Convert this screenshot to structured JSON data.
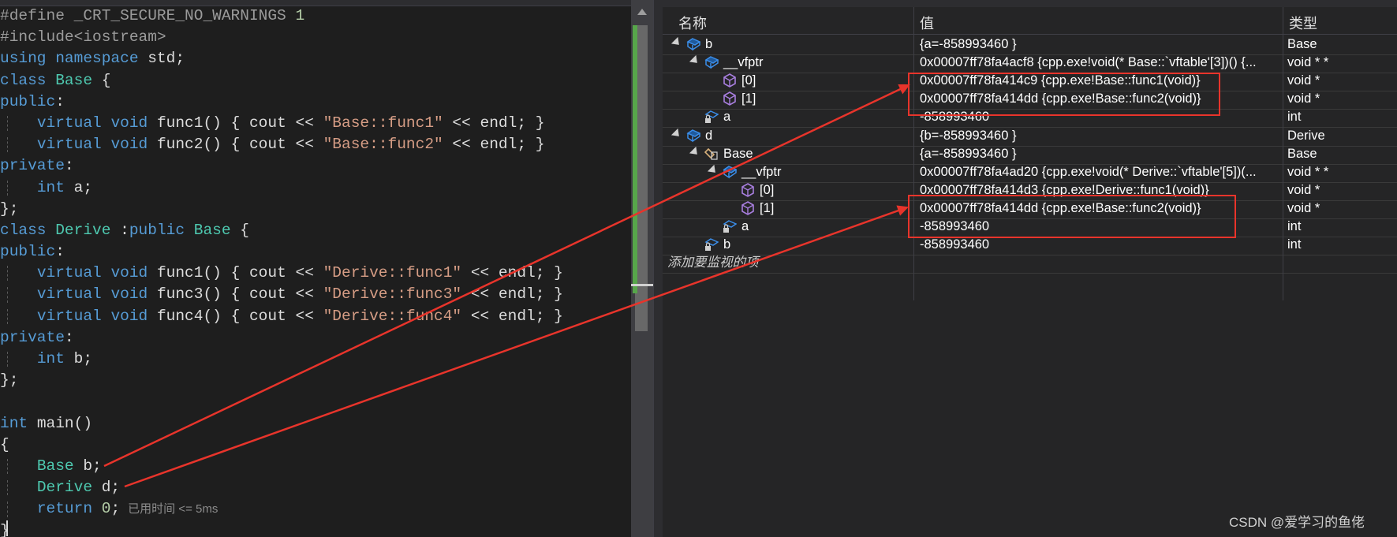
{
  "editor": {
    "lines": [
      {
        "t": "pp",
        "text": "#define _CRT_SECURE_NO_WARNINGS 1"
      },
      {
        "t": "pp",
        "text": "#include<iostream>"
      },
      {
        "t": "kw",
        "text": "using namespace std;"
      },
      {
        "t": "cls",
        "kw": "class",
        "name": "Base",
        "rest": " {"
      },
      {
        "t": "kw",
        "text": "public:"
      },
      {
        "t": "vf",
        "fn": "func1",
        "body": "{ cout << ",
        "str": "\"Base::func1\"",
        "tail": " << endl; }"
      },
      {
        "t": "vf",
        "fn": "func2",
        "body": "{ cout << ",
        "str": "\"Base::func2\"",
        "tail": " << endl; }"
      },
      {
        "t": "kw",
        "text": "private:"
      },
      {
        "t": "decl",
        "text": "int a;"
      },
      {
        "t": "plain",
        "text": "};"
      },
      {
        "t": "cls2",
        "kw": "class",
        "name": "Derive",
        "mid": " :public ",
        "base": "Base",
        "rest": " {"
      },
      {
        "t": "kw",
        "text": "public:"
      },
      {
        "t": "vf",
        "fn": "func1",
        "body": "{ cout << ",
        "str": "\"Derive::func1\"",
        "tail": " << endl; }"
      },
      {
        "t": "vf",
        "fn": "func3",
        "body": "{ cout << ",
        "str": "\"Derive::func3\"",
        "tail": " << endl; }"
      },
      {
        "t": "vf",
        "fn": "func4",
        "body": "{ cout << ",
        "str": "\"Derive::func4\"",
        "tail": " << endl; }"
      },
      {
        "t": "kw",
        "text": "private:"
      },
      {
        "t": "decl",
        "text": "int b;"
      },
      {
        "t": "plain",
        "text": "};"
      },
      {
        "t": "plain",
        "text": ""
      },
      {
        "t": "main",
        "text": "int main()"
      },
      {
        "t": "plain",
        "text": "{"
      },
      {
        "t": "var",
        "ty": "Base",
        "text": " b;"
      },
      {
        "t": "var",
        "ty": "Derive",
        "text": " d;"
      },
      {
        "t": "ret",
        "text": "return 0;",
        "perf": "已用时间 <= 5ms"
      },
      {
        "t": "plain",
        "text": "}"
      }
    ],
    "virtual_kw": "virtual",
    "void_kw": "void",
    "parens": "() "
  },
  "watch": {
    "headers": {
      "name": "名称",
      "value": "值",
      "type": "类型"
    },
    "rows": [
      {
        "level": 0,
        "expand": true,
        "icon": "object-icon",
        "name": "b",
        "value": "{a=-858993460 }",
        "type": "Base"
      },
      {
        "level": 1,
        "expand": true,
        "icon": "object-icon",
        "name": "__vfptr",
        "value": "0x00007ff78fa4acf8 {cpp.exe!void(* Base::`vftable'[3])() {...",
        "type": "void * *"
      },
      {
        "level": 2,
        "expand": false,
        "icon": "cube-icon",
        "name": "[0]",
        "value": "0x00007ff78fa414c9 {cpp.exe!Base::func1(void)}",
        "type": "void *"
      },
      {
        "level": 2,
        "expand": false,
        "icon": "cube-icon",
        "name": "[1]",
        "value": "0x00007ff78fa414dd {cpp.exe!Base::func2(void)}",
        "type": "void *"
      },
      {
        "level": 1,
        "expand": false,
        "icon": "private-field-icon",
        "name": "a",
        "value": "-858993460",
        "type": "int"
      },
      {
        "level": 0,
        "expand": true,
        "icon": "object-icon",
        "name": "d",
        "value": "{b=-858993460 }",
        "type": "Derive"
      },
      {
        "level": 1,
        "expand": true,
        "icon": "base-class-icon",
        "name": "Base",
        "value": "{a=-858993460 }",
        "type": "Base"
      },
      {
        "level": 2,
        "expand": true,
        "icon": "object-icon",
        "name": "__vfptr",
        "value": "0x00007ff78fa4ad20 {cpp.exe!void(* Derive::`vftable'[5])(...",
        "type": "void * *"
      },
      {
        "level": 3,
        "expand": false,
        "icon": "cube-icon",
        "name": "[0]",
        "value": "0x00007ff78fa414d3 {cpp.exe!Derive::func1(void)}",
        "type": "void *"
      },
      {
        "level": 3,
        "expand": false,
        "icon": "cube-icon",
        "name": "[1]",
        "value": "0x00007ff78fa414dd {cpp.exe!Base::func2(void)}",
        "type": "void *"
      },
      {
        "level": 2,
        "expand": false,
        "icon": "private-field-icon",
        "name": "a",
        "value": "-858993460",
        "type": "int"
      },
      {
        "level": 1,
        "expand": false,
        "icon": "private-field-icon",
        "name": "b",
        "value": "-858993460",
        "type": "int"
      }
    ],
    "add_watch": "添加要监视的项"
  },
  "watermark": "CSDN @爱学习的鱼佬",
  "colors": {
    "accent_red": "#e8342b",
    "green_bar": "#57a64a"
  }
}
